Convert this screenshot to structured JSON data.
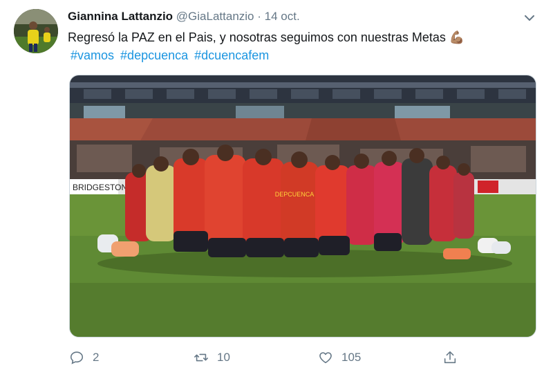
{
  "tweet": {
    "author_name": "Giannina Lattanzio",
    "handle": "@GiaLattanzio",
    "separator": "·",
    "date": "14 oct.",
    "text": "Regresó la PAZ en el Pais, y nosotras seguimos con nuestras Metas 💪🏽",
    "hashtags": [
      "#vamos",
      "#depcuenca",
      "#dcuencafem"
    ]
  },
  "photo": {
    "banner_text": "BRIDGESTONE",
    "jersey_text": "DEPCUENCA"
  },
  "actions": {
    "reply_count": "2",
    "retweet_count": "10",
    "like_count": "105"
  },
  "icons": {
    "reply": "reply-icon",
    "retweet": "retweet-icon",
    "like": "heart-icon",
    "share": "share-icon",
    "menu": "chevron-down-icon"
  },
  "colors": {
    "link": "#1b95e0",
    "muted": "#657786",
    "jersey_red": "#d93a2a",
    "pitch_green": "#5f8a34"
  }
}
